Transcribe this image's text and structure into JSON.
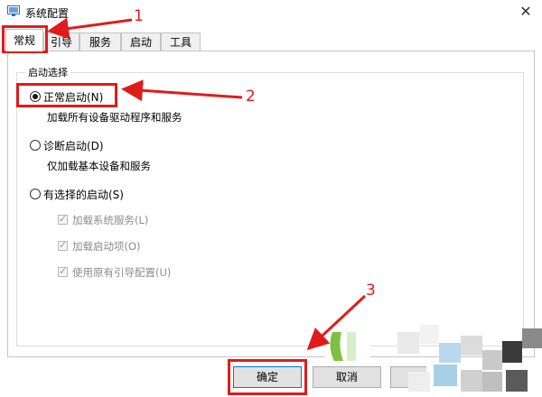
{
  "window": {
    "title": "系统配置",
    "close_glyph": "✕"
  },
  "tabs": [
    {
      "label": "常规",
      "active": true
    },
    {
      "label": "引导",
      "active": false
    },
    {
      "label": "服务",
      "active": false
    },
    {
      "label": "启动",
      "active": false
    },
    {
      "label": "工具",
      "active": false
    }
  ],
  "startup": {
    "group_label": "启动选择",
    "options": [
      {
        "label": "正常启动(N)",
        "description": "加载所有设备驱动程序和服务",
        "selected": true
      },
      {
        "label": "诊断启动(D)",
        "description": "仅加载基本设备和服务",
        "selected": false
      },
      {
        "label": "有选择的启动(S)",
        "description": "",
        "selected": false
      }
    ],
    "selective_items": [
      {
        "label": "加载系统服务(L)",
        "checked": true,
        "enabled": false
      },
      {
        "label": "加载启动项(O)",
        "checked": true,
        "enabled": false
      },
      {
        "label": "使用原有引导配置(U)",
        "checked": true,
        "enabled": false
      }
    ]
  },
  "buttons": {
    "ok": "确定",
    "cancel": "取消"
  },
  "annotations": {
    "step1": "1",
    "step2": "2",
    "step3": "3",
    "color": "#e01b1b"
  }
}
